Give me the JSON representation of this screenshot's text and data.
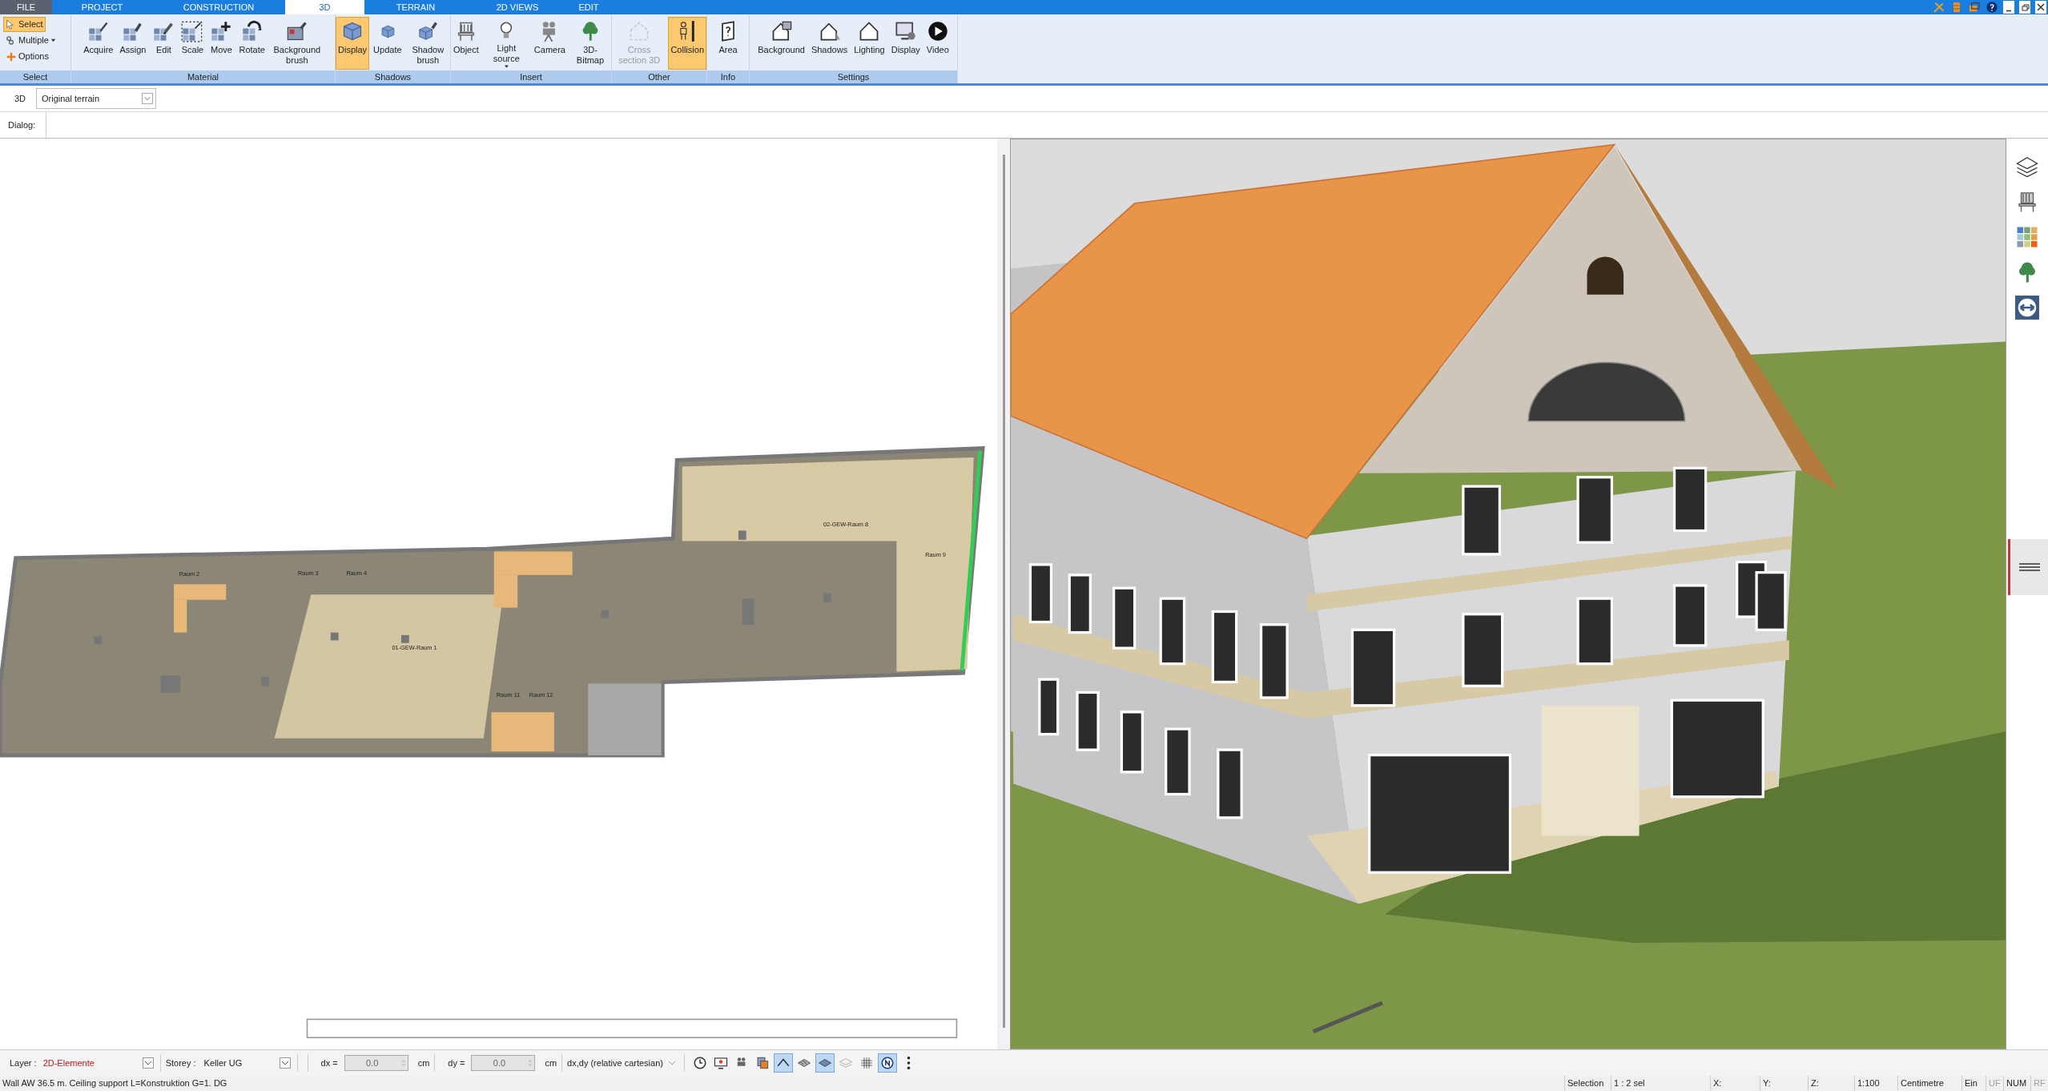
{
  "menu_tabs": [
    {
      "label": "FILE",
      "kind": "file",
      "selected": false
    },
    {
      "label": "PROJECT",
      "kind": "tab",
      "selected": false
    },
    {
      "label": "CONSTRUCTION",
      "kind": "tab",
      "selected": false
    },
    {
      "label": "3D",
      "kind": "tab",
      "selected": true
    },
    {
      "label": "TERRAIN",
      "kind": "tab",
      "selected": false
    },
    {
      "label": "2D VIEWS",
      "kind": "tab",
      "selected": false
    },
    {
      "label": "EDIT",
      "kind": "tab",
      "selected": false
    }
  ],
  "ribbon": {
    "groups": [
      {
        "label": "Select",
        "kind": "list",
        "buttons": [
          {
            "label": "Select",
            "selected": true,
            "disabled": false,
            "dropdown": false
          },
          {
            "label": "Multiple",
            "selected": false,
            "disabled": false,
            "dropdown": true
          },
          {
            "label": "Options",
            "selected": false,
            "disabled": false,
            "dropdown": false
          }
        ]
      },
      {
        "label": "Material",
        "kind": "large",
        "buttons": [
          {
            "label": "Acquire",
            "selected": false,
            "disabled": false,
            "dropdown": false
          },
          {
            "label": "Assign",
            "selected": false,
            "disabled": false,
            "dropdown": false
          },
          {
            "label": "Edit",
            "selected": false,
            "disabled": false,
            "dropdown": false
          },
          {
            "label": "Scale",
            "selected": false,
            "disabled": false,
            "dropdown": false
          },
          {
            "label": "Move",
            "selected": false,
            "disabled": false,
            "dropdown": false
          },
          {
            "label": "Rotate",
            "selected": false,
            "disabled": false,
            "dropdown": false
          },
          {
            "label": "Background brush",
            "selected": false,
            "disabled": false,
            "dropdown": false
          }
        ]
      },
      {
        "label": "Shadows",
        "kind": "large",
        "buttons": [
          {
            "label": "Display",
            "selected": true,
            "disabled": false,
            "dropdown": false
          },
          {
            "label": "Update",
            "selected": false,
            "disabled": false,
            "dropdown": false
          },
          {
            "label": "Shadow brush",
            "selected": false,
            "disabled": false,
            "dropdown": false
          }
        ]
      },
      {
        "label": "Insert",
        "kind": "large",
        "buttons": [
          {
            "label": "Object",
            "selected": false,
            "disabled": false,
            "dropdown": false
          },
          {
            "label": "Light source",
            "selected": false,
            "disabled": false,
            "dropdown": true
          },
          {
            "label": "Camera",
            "selected": false,
            "disabled": false,
            "dropdown": false
          },
          {
            "label": "3D-Bitmap",
            "selected": false,
            "disabled": false,
            "dropdown": false
          }
        ]
      },
      {
        "label": "Other",
        "kind": "large",
        "buttons": [
          {
            "label": "Cross section 3D",
            "selected": false,
            "disabled": true,
            "dropdown": false
          },
          {
            "label": "Collision",
            "selected": true,
            "disabled": false,
            "dropdown": false
          }
        ]
      },
      {
        "label": "Info",
        "kind": "large",
        "buttons": [
          {
            "label": "Area",
            "selected": false,
            "disabled": false,
            "dropdown": false
          }
        ]
      },
      {
        "label": "Settings",
        "kind": "large",
        "buttons": [
          {
            "label": "Background",
            "selected": false,
            "disabled": false,
            "dropdown": false
          },
          {
            "label": "Shadows",
            "selected": false,
            "disabled": false,
            "dropdown": false
          },
          {
            "label": "Lighting",
            "selected": false,
            "disabled": false,
            "dropdown": false
          },
          {
            "label": "Display",
            "selected": false,
            "disabled": false,
            "dropdown": false
          },
          {
            "label": "Video",
            "selected": false,
            "disabled": false,
            "dropdown": false
          }
        ]
      }
    ]
  },
  "view_bar": {
    "view_label": "3D",
    "terrain": "Original terrain"
  },
  "dialog_bar": {
    "label": "Dialog:"
  },
  "floor_plan": {
    "room_labels": [
      "Raum 2",
      "Raum 3",
      "Raum 4",
      "01-GEW-Raum 1",
      "02-GEW-Raum 8",
      "Raum 9",
      "Raum 11",
      "Raum 12"
    ]
  },
  "bottom_toolbar": {
    "layer": {
      "label": "Layer :",
      "value": "2D-Elemente"
    },
    "storey": {
      "label": "Storey :",
      "value": "Keller UG"
    },
    "dx": {
      "label": "dx =",
      "value": "0.0",
      "unit": "cm",
      "disabled": true
    },
    "dy": {
      "label": "dy =",
      "value": "0.0",
      "unit": "cm",
      "disabled": true
    },
    "coordinate_mode": "dx,dy (relative cartesian)",
    "tools": [
      {
        "selected": false
      },
      {
        "selected": false
      },
      {
        "selected": false
      },
      {
        "selected": false
      },
      {
        "selected": true
      },
      {
        "selected": false
      },
      {
        "selected": true
      },
      {
        "selected": false
      },
      {
        "selected": false
      },
      {
        "selected": true
      },
      {
        "selected": false
      }
    ]
  },
  "status_bar": {
    "message": "Wall AW 36.5 m. Ceiling support L=Konstruktion G=1. DG",
    "fields": [
      {
        "text": "Selection",
        "active": true
      },
      {
        "text": "1 : 2 sel",
        "active": true
      },
      {
        "text": "X:",
        "active": true
      },
      {
        "text": "Y:",
        "active": true
      },
      {
        "text": "Z:",
        "active": true
      },
      {
        "text": "1:100",
        "active": true
      },
      {
        "text": "Centimetre",
        "active": true
      },
      {
        "text": "Ein",
        "active": true
      },
      {
        "text": "UF",
        "active": false
      },
      {
        "text": "NUM",
        "active": true
      },
      {
        "text": "RF",
        "active": false
      }
    ]
  }
}
